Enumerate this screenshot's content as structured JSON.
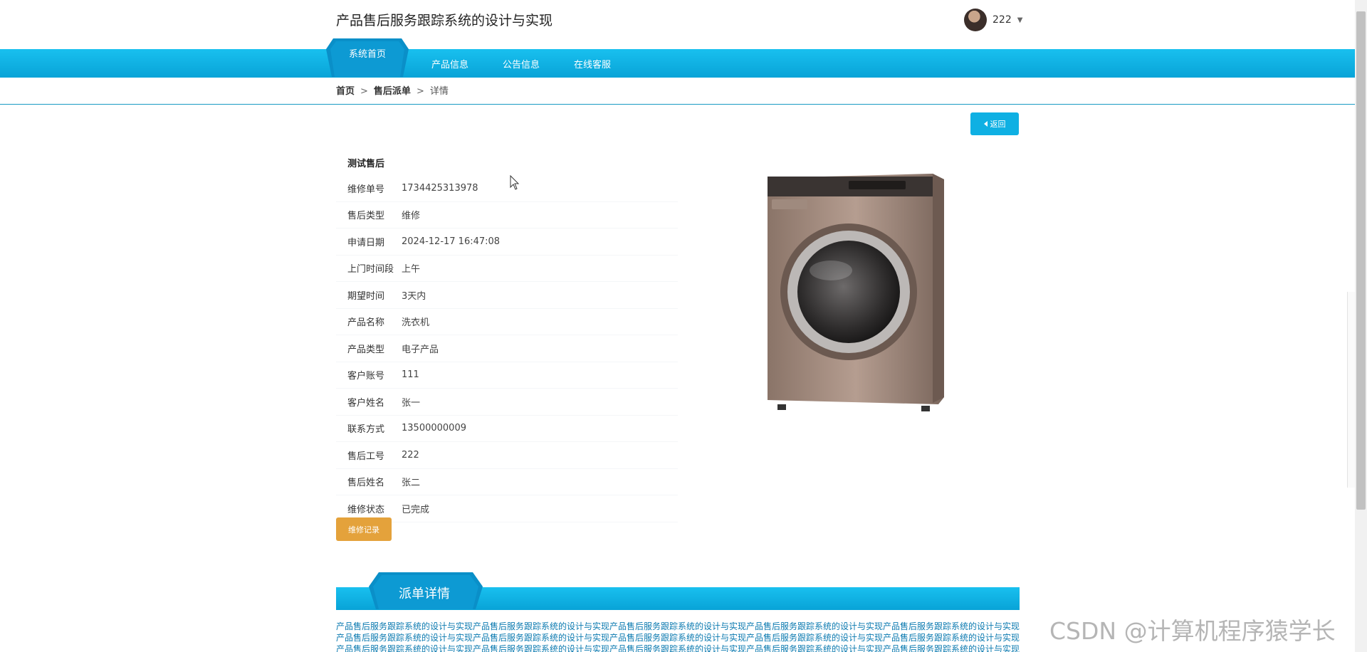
{
  "header": {
    "site_title": "产品售后服务跟踪系统的设计与实现",
    "username": "222"
  },
  "nav": {
    "items": [
      "系统首页",
      "产品信息",
      "公告信息",
      "在线客服"
    ],
    "active_index": 0
  },
  "breadcrumb": {
    "home": "首页",
    "section": "售后派单",
    "sep": ">",
    "current": "详情"
  },
  "back_label": "返回",
  "detail": {
    "title": "测试售后",
    "rows": [
      {
        "label": "维修单号",
        "value": "1734425313978"
      },
      {
        "label": "售后类型",
        "value": "维修"
      },
      {
        "label": "申请日期",
        "value": "2024-12-17 16:47:08"
      },
      {
        "label": "上门时间段",
        "value": "上午"
      },
      {
        "label": "期望时间",
        "value": "3天内"
      },
      {
        "label": "产品名称",
        "value": "洗衣机"
      },
      {
        "label": "产品类型",
        "value": "电子产品"
      },
      {
        "label": "客户账号",
        "value": "111"
      },
      {
        "label": "客户姓名",
        "value": "张一"
      },
      {
        "label": "联系方式",
        "value": "13500000009"
      },
      {
        "label": "售后工号",
        "value": "222"
      },
      {
        "label": "售后姓名",
        "value": "张二"
      },
      {
        "label": "维修状态",
        "value": "已完成"
      }
    ],
    "repair_button": "维修记录"
  },
  "section": {
    "title": "派单详情",
    "text": "产品售后服务跟踪系统的设计与实现产品售后服务跟踪系统的设计与实现产品售后服务跟踪系统的设计与实现产品售后服务跟踪系统的设计与实现产品售后服务跟踪系统的设计与实现产品售后服务跟踪系统的设计与实现产品售后服务跟踪系统的设计与实现产品售后服务跟踪系统的设计与实现产品售后服务跟踪系统的设计与实现产品售后服务跟踪系统的设计与实现产品售后服务跟踪系统的设计与实现产品售后服务跟踪系统的设计与实现产品售后服务跟踪系统的设计与实现产品售后服务跟踪系统的设计与实现产品售后服务跟踪系统的设计与实现"
  },
  "watermark": "CSDN @计算机程序猿学长",
  "colors": {
    "nav": "#08a3d7",
    "back_button": "#0fb0e3",
    "repair_button": "#e4a23b"
  }
}
